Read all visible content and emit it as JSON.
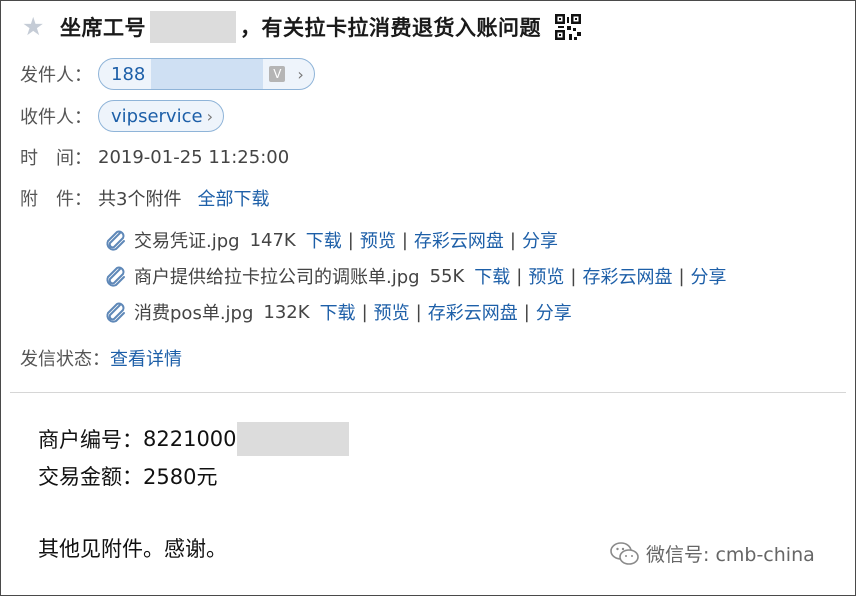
{
  "subject": {
    "prefix": "坐席工号",
    "suffix": "，有关拉卡拉消费退货入账问题"
  },
  "sender": {
    "label": "发件人：",
    "value_prefix": "188"
  },
  "recipient": {
    "label": "收件人：",
    "value": "vipservice"
  },
  "time": {
    "label": "时　间：",
    "value": "2019-01-25 11:25:00"
  },
  "attachments": {
    "label": "附　件：",
    "summary": "共3个附件",
    "download_all": "全部下载",
    "items": [
      {
        "name": "交易凭证.jpg",
        "size": "147K"
      },
      {
        "name": "商户提供给拉卡拉公司的调账单.jpg",
        "size": "55K"
      },
      {
        "name": "消费pos单.jpg",
        "size": "132K"
      }
    ],
    "actions": {
      "download": "下载",
      "preview": "预览",
      "save_cloud": "存彩云网盘",
      "share": "分享",
      "separator": "|"
    }
  },
  "status": {
    "label": "发信状态：",
    "link": "查看详情"
  },
  "body": {
    "merchant_label": "商户编号：",
    "merchant_value_prefix": "8221000",
    "amount_line": "交易金额：2580元",
    "closing": "其他见附件。感谢。"
  },
  "watermark": {
    "text": "微信号: cmb-china"
  },
  "colors": {
    "link": "#1d5fa8",
    "pill_border": "#8fb4d8",
    "pill_bg": "#eef4fb",
    "redaction": "#dcdcdc"
  },
  "icons": {
    "star": "star-icon",
    "qr": "qr-code-icon",
    "attachment": "paperclip-icon",
    "chevron": "chevron-right-icon",
    "dropdown": "v-dropdown-icon",
    "wechat": "wechat-logo-icon"
  }
}
